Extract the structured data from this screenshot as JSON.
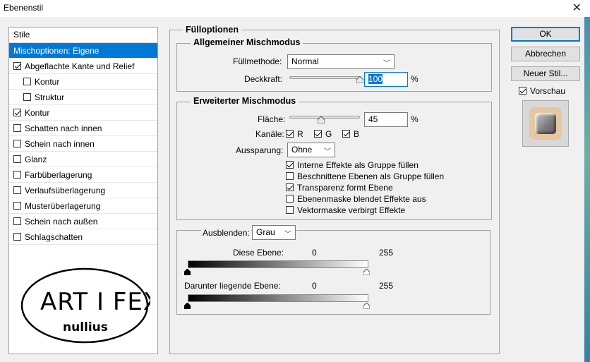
{
  "window": {
    "title": "Ebenenstil"
  },
  "sidebar": {
    "header": "Stile",
    "items": [
      {
        "label": "Mischoptionen: Eigene",
        "checkbox": null,
        "selected": true,
        "indent": false
      },
      {
        "label": "Abgeflachte Kante und Relief",
        "checkbox": true,
        "selected": false,
        "indent": false
      },
      {
        "label": "Kontur",
        "checkbox": false,
        "selected": false,
        "indent": true
      },
      {
        "label": "Struktur",
        "checkbox": false,
        "selected": false,
        "indent": true
      },
      {
        "label": "Kontur",
        "checkbox": true,
        "selected": false,
        "indent": false
      },
      {
        "label": "Schatten nach innen",
        "checkbox": false,
        "selected": false,
        "indent": false
      },
      {
        "label": "Schein nach innen",
        "checkbox": false,
        "selected": false,
        "indent": false
      },
      {
        "label": "Glanz",
        "checkbox": false,
        "selected": false,
        "indent": false
      },
      {
        "label": "Farbüberlagerung",
        "checkbox": false,
        "selected": false,
        "indent": false
      },
      {
        "label": "Verlaufsüberlagerung",
        "checkbox": false,
        "selected": false,
        "indent": false
      },
      {
        "label": "Musterüberlagerung",
        "checkbox": false,
        "selected": false,
        "indent": false
      },
      {
        "label": "Schein nach außen",
        "checkbox": false,
        "selected": false,
        "indent": false
      },
      {
        "label": "Schlagschatten",
        "checkbox": false,
        "selected": false,
        "indent": false
      }
    ],
    "logo": {
      "line1": "ART I FEX",
      "line2": "nullius"
    }
  },
  "fill": {
    "title": "Fülloptionen",
    "general": {
      "title": "Allgemeiner Mischmodus",
      "blend_label": "Füllmethode:",
      "blend_value": "Normal",
      "opacity_label": "Deckkraft:",
      "opacity_value": "100",
      "opacity_unit": "%",
      "opacity_fraction": 1.0
    },
    "advanced": {
      "title": "Erweiterter Mischmodus",
      "fill_label": "Fläche:",
      "fill_value": "45",
      "fill_unit": "%",
      "fill_fraction": 0.45,
      "channels_label": "Kanäle:",
      "channel_r": "R",
      "channel_g": "G",
      "channel_b": "B",
      "knockout_label": "Aussparung:",
      "knockout_value": "Ohne",
      "options": [
        {
          "label": "Interne Effekte als Gruppe füllen",
          "checked": true
        },
        {
          "label": "Beschnittene Ebenen als Gruppe füllen",
          "checked": false
        },
        {
          "label": "Transparenz formt Ebene",
          "checked": true
        },
        {
          "label": "Ebenenmaske blendet Effekte aus",
          "checked": false
        },
        {
          "label": "Vektormaske verbirgt Effekte",
          "checked": false
        }
      ]
    },
    "blendif": {
      "label": "Ausblenden:",
      "value": "Grau",
      "this_layer": {
        "label": "Diese Ebene:",
        "min": "0",
        "max": "255"
      },
      "underlying": {
        "label": "Darunter liegende Ebene:",
        "min": "0",
        "max": "255"
      }
    }
  },
  "buttons": {
    "ok": "OK",
    "cancel": "Abbrechen",
    "new_style": "Neuer Stil...",
    "preview_label": "Vorschau",
    "preview_checked": true
  },
  "colors": {
    "accent": "#0078d7",
    "preview_frame": "#e6c7a0"
  }
}
